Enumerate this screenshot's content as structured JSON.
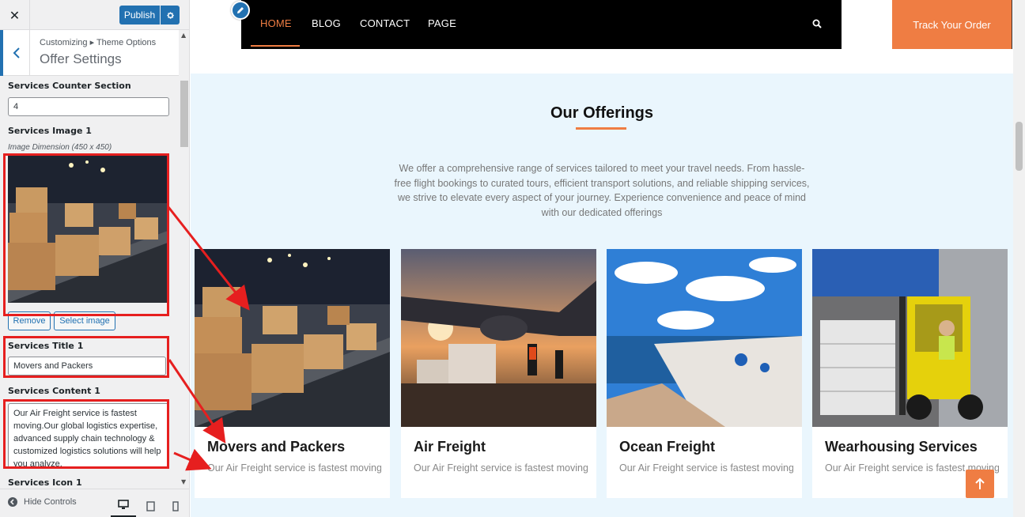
{
  "topbar": {
    "close_glyph": "✕",
    "publish_label": "Publish"
  },
  "section_header": {
    "breadcrumb": "Customizing ▸ Theme Options",
    "title": "Offer Settings"
  },
  "controls": {
    "counter_label": "Services Counter Section",
    "counter_value": "4",
    "image_label": "Services Image 1",
    "image_dimension": "Image Dimension (450 x 450)",
    "remove_label": "Remove",
    "select_image_label": "Select image",
    "title_label": "Services Title 1",
    "title_value": "Movers and Packers",
    "content_label": "Services Content 1",
    "content_value": "Our Air Freight service is fastest moving.Our global logistics expertise, advanced supply chain technology & customized logistics solutions will help you analyze.",
    "icon_label": "Services Icon 1"
  },
  "footer": {
    "hide_controls_label": "Hide Controls"
  },
  "nav": {
    "items": [
      "HOME",
      "BLOG",
      "CONTACT",
      "PAGE"
    ],
    "track_order_label": "Track Your Order"
  },
  "offerings": {
    "title": "Our Offerings",
    "description": "We offer a comprehensive range of services tailored to meet your travel needs. From hassle-free flight bookings to curated tours, efficient transport solutions, and reliable shipping services, we strive to elevate every aspect of your journey. Experience convenience and peace of mind with our dedicated offerings",
    "cards": [
      {
        "title": "Movers and Packers",
        "text": "Our Air Freight service is fastest moving."
      },
      {
        "title": "Air Freight",
        "text": "Our Air Freight service is fastest moving."
      },
      {
        "title": "Ocean Freight",
        "text": "Our Air Freight service is fastest moving."
      },
      {
        "title": "Wearhousing Services",
        "text": "Our Air Freight service is fastest moving."
      }
    ]
  },
  "colors": {
    "accent": "#ef7d43",
    "wp_blue": "#2271b1",
    "annotation_red": "#e61f1f",
    "section_bg": "#eaf6fd"
  }
}
